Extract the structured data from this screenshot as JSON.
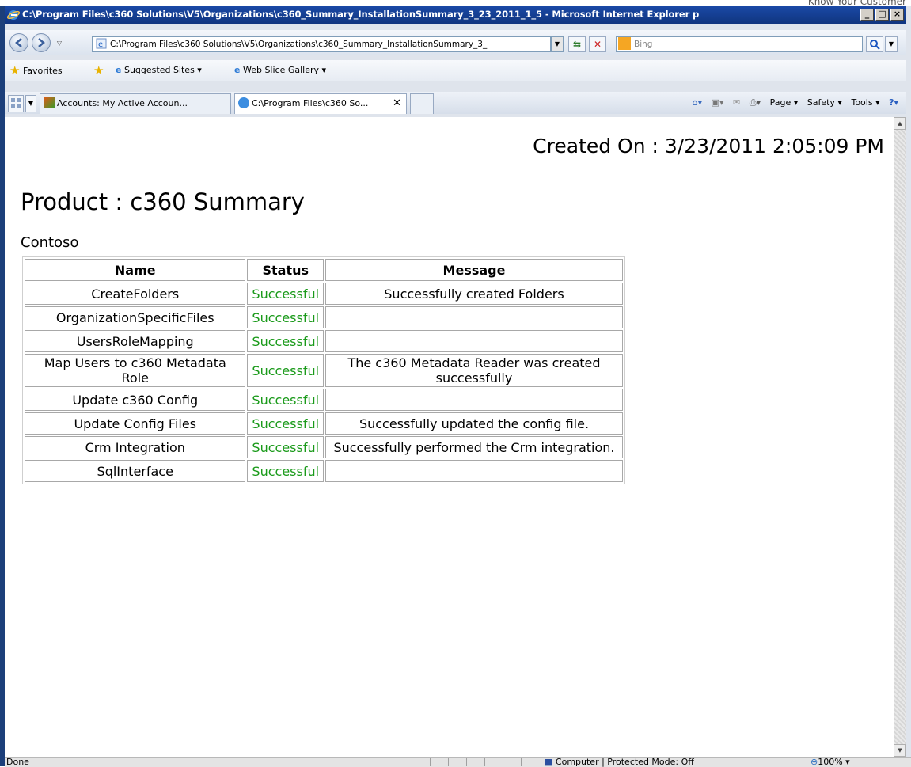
{
  "corner_tag": "Know Your Customer",
  "window": {
    "title": "C:\\Program Files\\c360 Solutions\\V5\\Organizations\\c360_Summary_InstallationSummary_3_23_2011_1_5 - Microsoft Internet Explorer p",
    "minimize_label": "_",
    "maximize_label": "□",
    "close_label": "×"
  },
  "address_bar": {
    "url": "C:\\Program Files\\c360 Solutions\\V5\\Organizations\\c360_Summary_InstallationSummary_3_",
    "search_placeholder": "Bing"
  },
  "favorites_bar": {
    "favorites_label": "Favorites",
    "suggested_sites_label": "Suggested Sites ▾",
    "web_slice_label": "Web Slice Gallery ▾"
  },
  "tabs": [
    {
      "label": "Accounts: My Active Accoun..."
    },
    {
      "label": "C:\\Program Files\\c360 So..."
    }
  ],
  "command_bar": {
    "page_label": "Page ▾",
    "safety_label": "Safety ▾",
    "tools_label": "Tools ▾"
  },
  "page": {
    "created_on": "Created On : 3/23/2011 2:05:09 PM",
    "product_title": "Product : c360 Summary",
    "organization": "Contoso",
    "table": {
      "headers": [
        "Name",
        "Status",
        "Message"
      ],
      "rows": [
        {
          "name": "CreateFolders",
          "status": "Successful",
          "message": "Successfully created Folders"
        },
        {
          "name": "OrganizationSpecificFiles",
          "status": "Successful",
          "message": ""
        },
        {
          "name": "UsersRoleMapping",
          "status": "Successful",
          "message": ""
        },
        {
          "name": "Map Users to c360 Metadata Role",
          "status": "Successful",
          "message": "The c360 Metadata Reader was created successfully"
        },
        {
          "name": "Update c360 Config",
          "status": "Successful",
          "message": ""
        },
        {
          "name": "Update Config Files",
          "status": "Successful",
          "message": "Successfully updated the config file."
        },
        {
          "name": "Crm Integration",
          "status": "Successful",
          "message": "Successfully performed the Crm integration."
        },
        {
          "name": "SqlInterface",
          "status": "Successful",
          "message": ""
        }
      ]
    }
  },
  "status_bar": {
    "left_text": "Done",
    "zone_text": "Computer | Protected Mode: Off",
    "zoom_text": "100%"
  },
  "colors": {
    "status_success": "#1a9a1a",
    "title_bar": "#1a49a6"
  }
}
